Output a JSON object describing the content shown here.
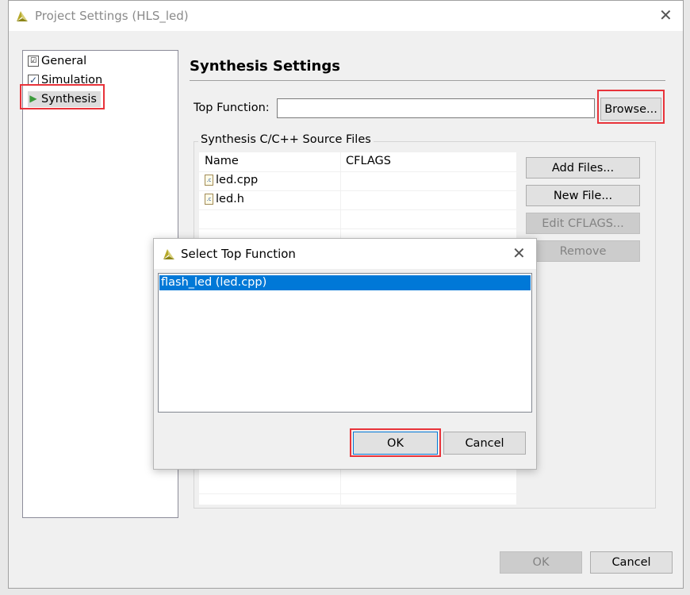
{
  "window": {
    "title": "Project Settings (HLS_led)",
    "close_icon": "close-icon"
  },
  "tree": {
    "items": [
      {
        "label": "General",
        "icon": "general-settings-icon"
      },
      {
        "label": "Simulation",
        "icon": "checkbox-icon"
      },
      {
        "label": "Synthesis",
        "icon": "play-triangle-icon",
        "selected": true
      }
    ]
  },
  "main": {
    "heading": "Synthesis Settings",
    "top_function_label": "Top Function:",
    "top_function_value": "",
    "browse_label": "Browse...",
    "group_title": "Synthesis C/C++ Source Files",
    "table": {
      "columns": [
        "Name",
        "CFLAGS"
      ],
      "rows": [
        {
          "name": "led.cpp",
          "cflags": ""
        },
        {
          "name": "led.h",
          "cflags": ""
        }
      ],
      "file_icon_glyph": ".c"
    },
    "buttons": {
      "add_files": "Add Files...",
      "new_file": "New File...",
      "edit_cflags": "Edit CFLAGS...",
      "remove": "Remove"
    }
  },
  "footer": {
    "ok": "OK",
    "cancel": "Cancel"
  },
  "dialog": {
    "title": "Select Top Function",
    "items": [
      {
        "label": "flash_led (led.cpp)",
        "selected": true
      }
    ],
    "ok": "OK",
    "cancel": "Cancel"
  },
  "colors": {
    "selection": "#0078d7",
    "highlight_box": "#e8333a"
  }
}
